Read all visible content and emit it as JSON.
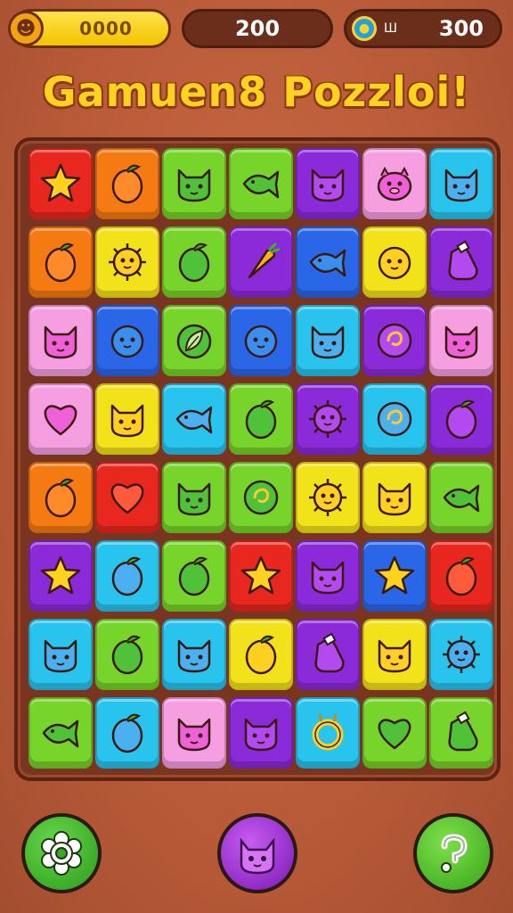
{
  "hud": {
    "coins": "0000",
    "score": "200",
    "lives_symbol": "Ш",
    "lives": "300"
  },
  "title": "Gamuen8 Pozzloi!",
  "board": {
    "rows": [
      [
        "star-red",
        "fruit-orange",
        "cat-green",
        "fish-green",
        "cat-purple",
        "pig-pink",
        "cat-cyan"
      ],
      [
        "fruit-orange",
        "virus-yellow",
        "fruit-green",
        "carrot-purple",
        "fish-blue",
        "slime-yellow",
        "bottle-purple"
      ],
      [
        "cat-pink",
        "slime-blue",
        "leaf-green",
        "slime-blue",
        "cat-cyan",
        "orb-purple",
        "cat-pink"
      ],
      [
        "heart-pink",
        "cat-yellow",
        "fish-cyan",
        "fruit-green",
        "virus-purple",
        "orb-cyan",
        "fruit-purple"
      ],
      [
        "fruit-orange",
        "heart-red",
        "cat-green",
        "orb-green",
        "virus-yellow",
        "cat-yellow",
        "fish-green"
      ],
      [
        "star-purple",
        "fruit-cyan",
        "fruit-green",
        "star-red",
        "cat-purple",
        "star-blue",
        "fruit-red"
      ],
      [
        "cat-cyan",
        "fruit-green",
        "cat-cyan",
        "fruit-yellow",
        "bottle-purple",
        "cat-yellow",
        "virus-cyan"
      ],
      [
        "fish-green",
        "fruit-cyan",
        "cat-pink",
        "cat-purple",
        "ring-cyan",
        "heart-green",
        "bottle-green"
      ]
    ]
  },
  "buttons": {
    "settings_icon": "gear-icon",
    "character_icon": "cat-icon",
    "help_icon": "question-icon"
  }
}
